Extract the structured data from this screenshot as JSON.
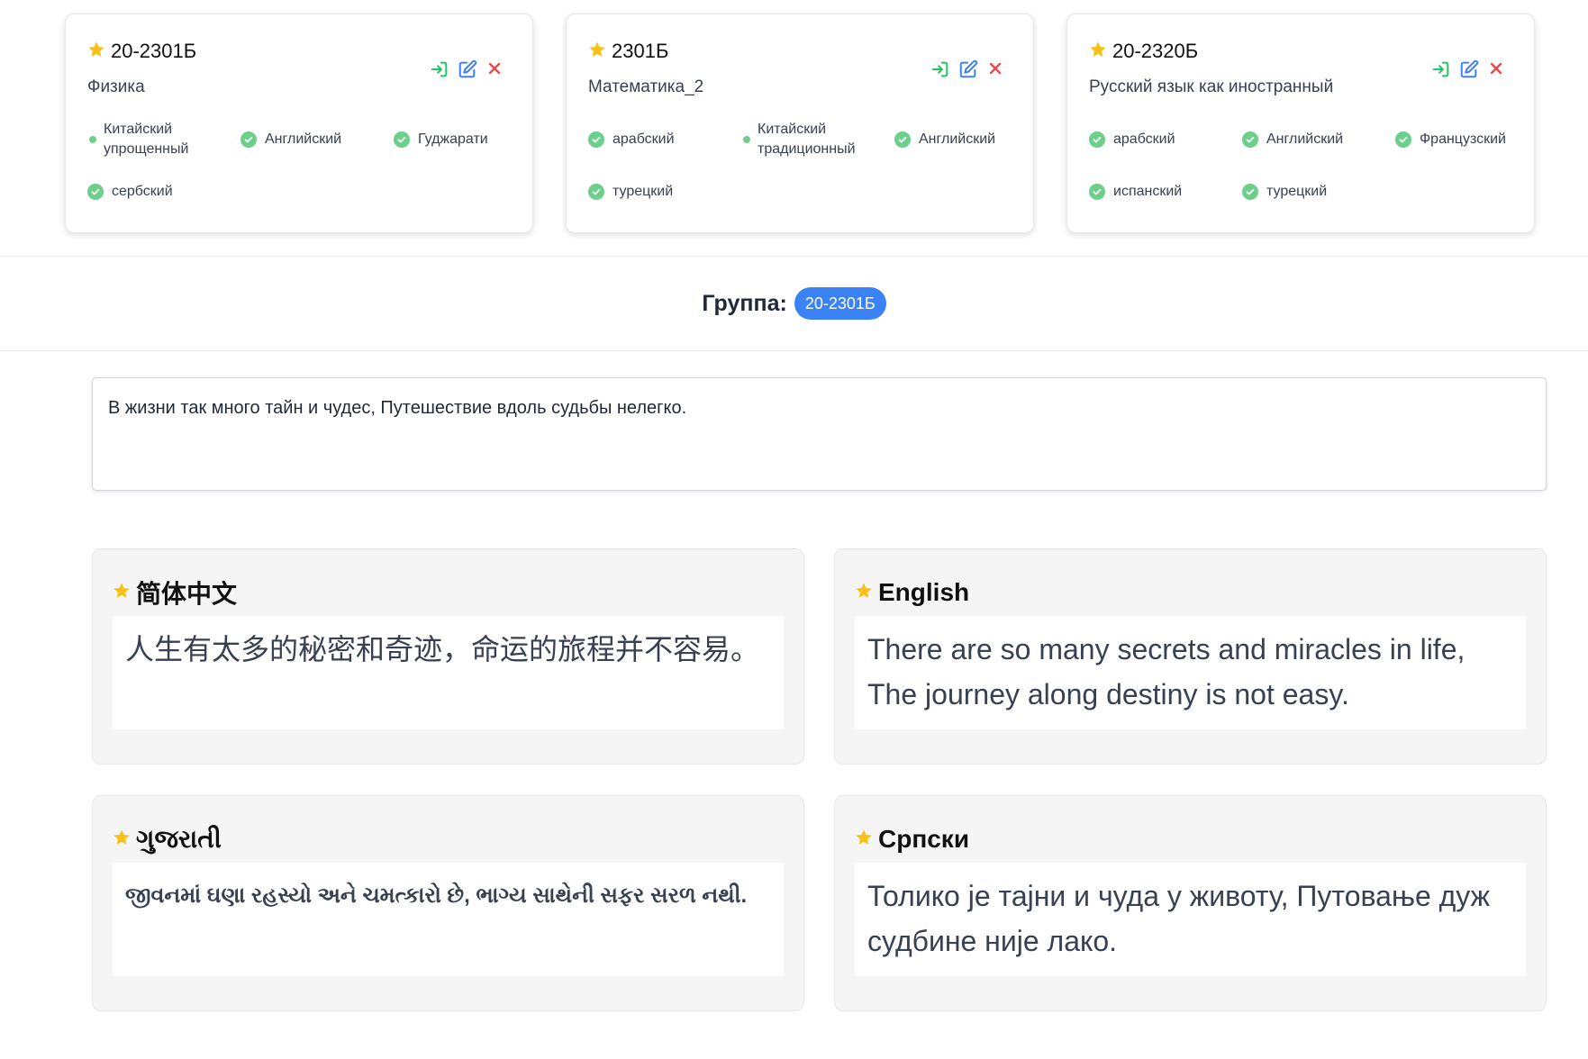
{
  "groups": [
    {
      "code": "20-2301Б",
      "subject": "Физика",
      "languages": [
        {
          "label": "Китайский упрощенный",
          "small_dot": true
        },
        {
          "label": "Английский",
          "small_dot": false
        },
        {
          "label": "Гуджарати",
          "small_dot": false
        },
        {
          "label": "сербский",
          "small_dot": false
        }
      ]
    },
    {
      "code": "2301Б",
      "subject": "Математика_2",
      "languages": [
        {
          "label": "арабский",
          "small_dot": false
        },
        {
          "label": "Китайский традиционный",
          "small_dot": true
        },
        {
          "label": "Английский",
          "small_dot": false
        },
        {
          "label": "турецкий",
          "small_dot": false
        }
      ]
    },
    {
      "code": "20-2320Б",
      "subject": "Русский язык как иностранный",
      "languages": [
        {
          "label": "арабский",
          "small_dot": false
        },
        {
          "label": "Английский",
          "small_dot": false
        },
        {
          "label": "Французский",
          "small_dot": false
        },
        {
          "label": "испанский",
          "small_dot": false
        },
        {
          "label": "турецкий",
          "small_dot": false
        }
      ]
    }
  ],
  "group_bar": {
    "label": "Группа:",
    "badge": "20-2301Б"
  },
  "source_text": "В жизни так много тайн и чудес, Путешествие вдоль судьбы нелегко.",
  "translations": [
    {
      "title": "简体中文",
      "text": "人生有太多的秘密和奇迹，命运的旅程并不容易。",
      "script": "zh"
    },
    {
      "title": "English",
      "text": "There are so many secrets and miracles in life, The journey along destiny is not easy.",
      "script": "en"
    },
    {
      "title": "ગુજરાતી",
      "text": "જીવનમાં ઘણા રહસ્યો અને ચમત્કારો છે, ભાગ્ય સાથેની સફર સરળ નથી.",
      "script": "gu"
    },
    {
      "title": "Српски",
      "text": "Толико је тајни и чуда у животу, Путовање дуж судбине није лако.",
      "script": "sr"
    }
  ],
  "colors": {
    "star": "#f8c11a",
    "check": "#6cd08a",
    "enter_icon": "#22c55e",
    "edit_icon": "#3b82f6",
    "delete_icon": "#ef4444",
    "badge": "#3b82f6"
  },
  "icons": {
    "enter": "login-arrow-icon",
    "edit": "edit-icon",
    "delete": "close-icon",
    "star": "star-icon",
    "check": "check-circle-icon"
  }
}
